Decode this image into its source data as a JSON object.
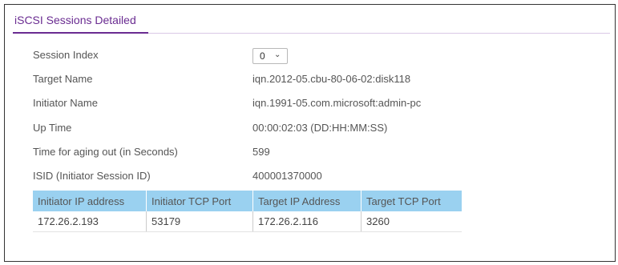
{
  "panel": {
    "title": "iSCSI Sessions Detailed"
  },
  "fields": {
    "session_index": {
      "label": "Session Index",
      "value": "0",
      "chevron": "⌄"
    },
    "target_name": {
      "label": "Target Name",
      "value": "iqn.2012-05.cbu-80-06-02:disk118"
    },
    "initiator_name": {
      "label": "Initiator Name",
      "value": "iqn.1991-05.com.microsoft:admin-pc"
    },
    "up_time": {
      "label": "Up Time",
      "value": "00:00:02:03 (DD:HH:MM:SS)"
    },
    "aging_out": {
      "label": "Time for aging out (in Seconds)",
      "value": "599"
    },
    "isid": {
      "label": "ISID (Initiator Session ID)",
      "value": "400001370000"
    }
  },
  "connections_table": {
    "headers": [
      "Initiator IP address",
      "Initiator TCP Port",
      "Target IP Address",
      "Target TCP Port"
    ],
    "rows": [
      [
        "172.26.2.193",
        "53179",
        "172.26.2.116",
        "3260"
      ]
    ]
  },
  "colors": {
    "accent": "#6a2c91",
    "table_header_bg": "#9ad1f0"
  },
  "icons": {
    "dropdown": "chevron-down-icon"
  }
}
